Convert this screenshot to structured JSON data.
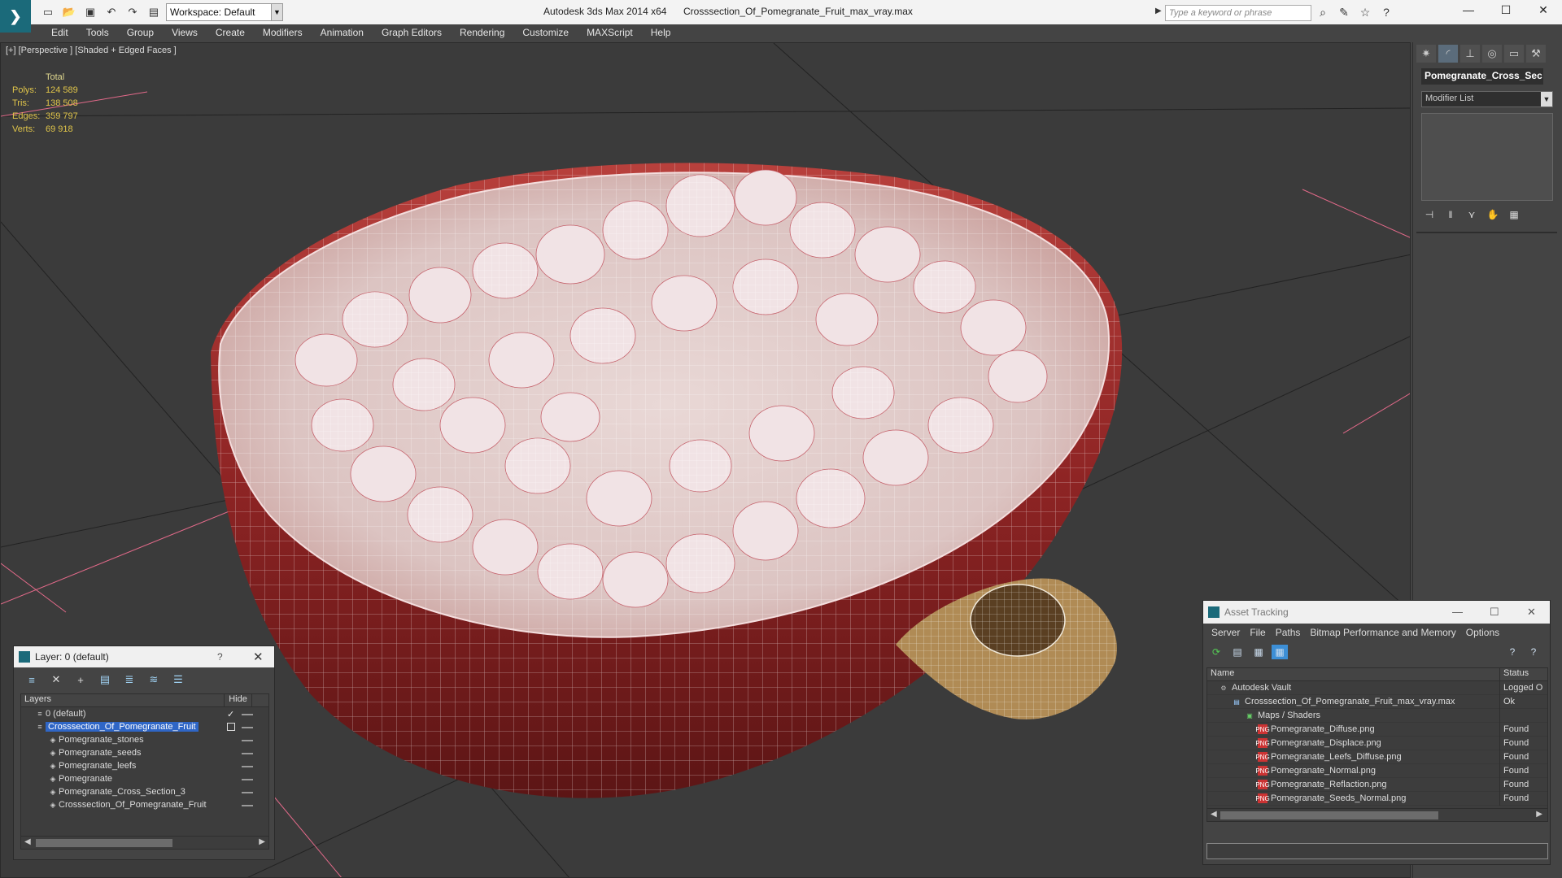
{
  "window": {
    "app_title": "Autodesk 3ds Max  2014 x64",
    "file_title": "Crosssection_Of_Pomegranate_Fruit_max_vray.max",
    "workspace": "Workspace: Default",
    "search_placeholder": "Type a keyword or phrase",
    "controls": {
      "minimize": "—",
      "maximize": "☐",
      "close": "✕"
    }
  },
  "menu": [
    "Edit",
    "Tools",
    "Group",
    "Views",
    "Create",
    "Modifiers",
    "Animation",
    "Graph Editors",
    "Rendering",
    "Customize",
    "MAXScript",
    "Help"
  ],
  "viewport": {
    "label": "[+] [Perspective ] [Shaded + Edged Faces ]",
    "stats": {
      "header": "Total",
      "rows": [
        {
          "label": "Polys:",
          "value": "124 589"
        },
        {
          "label": "Tris:",
          "value": "138 508"
        },
        {
          "label": "Edges:",
          "value": "359 797"
        },
        {
          "label": "Verts:",
          "value": "69 918"
        }
      ]
    }
  },
  "command_panel": {
    "object_name": "Pomegranate_Cross_Sec",
    "modifier_list": "Modifier List"
  },
  "layer_dialog": {
    "title": "Layer: 0 (default)",
    "help": "?",
    "close": "✕",
    "col_layers": "Layers",
    "col_hide": "Hide",
    "rows": [
      {
        "name": "0 (default)",
        "level": 0,
        "checked": true,
        "selected": false
      },
      {
        "name": "Crosssection_Of_Pomegranate_Fruit",
        "level": 0,
        "checked": false,
        "selected": true
      },
      {
        "name": "Pomegranate_stones",
        "level": 1,
        "checked": false,
        "selected": false
      },
      {
        "name": "Pomegranate_seeds",
        "level": 1,
        "checked": false,
        "selected": false
      },
      {
        "name": "Pomegranate_leefs",
        "level": 1,
        "checked": false,
        "selected": false
      },
      {
        "name": "Pomegranate",
        "level": 1,
        "checked": false,
        "selected": false
      },
      {
        "name": "Pomegranate_Cross_Section_3",
        "level": 1,
        "checked": false,
        "selected": false
      },
      {
        "name": "Crosssection_Of_Pomegranate_Fruit",
        "level": 1,
        "checked": false,
        "selected": false
      }
    ]
  },
  "asset_dialog": {
    "title": "Asset Tracking",
    "menu": [
      "Server",
      "File",
      "Paths",
      "Bitmap Performance and Memory",
      "Options"
    ],
    "col_name": "Name",
    "col_status": "Status",
    "rows": [
      {
        "name": "Autodesk Vault",
        "level": 0,
        "status": "Logged O",
        "icon": "vault"
      },
      {
        "name": "Crosssection_Of_Pomegranate_Fruit_max_vray.max",
        "level": 1,
        "status": "Ok",
        "icon": "max"
      },
      {
        "name": "Maps / Shaders",
        "level": 2,
        "status": "",
        "icon": "folder"
      },
      {
        "name": "Pomegranate_Diffuse.png",
        "level": 3,
        "status": "Found",
        "icon": "png"
      },
      {
        "name": "Pomegranate_Displace.png",
        "level": 3,
        "status": "Found",
        "icon": "png"
      },
      {
        "name": "Pomegranate_Leefs_Diffuse.png",
        "level": 3,
        "status": "Found",
        "icon": "png"
      },
      {
        "name": "Pomegranate_Normal.png",
        "level": 3,
        "status": "Found",
        "icon": "png"
      },
      {
        "name": "Pomegranate_Reflaction.png",
        "level": 3,
        "status": "Found",
        "icon": "png"
      },
      {
        "name": "Pomegranate_Seeds_Normal.png",
        "level": 3,
        "status": "Found",
        "icon": "png"
      }
    ]
  },
  "colors": {
    "viewport_bg": "#3b3b3b",
    "stats_text": "#e0c54a",
    "selection": "#2f66c6",
    "fruit_skin": "#9c2a2a"
  }
}
